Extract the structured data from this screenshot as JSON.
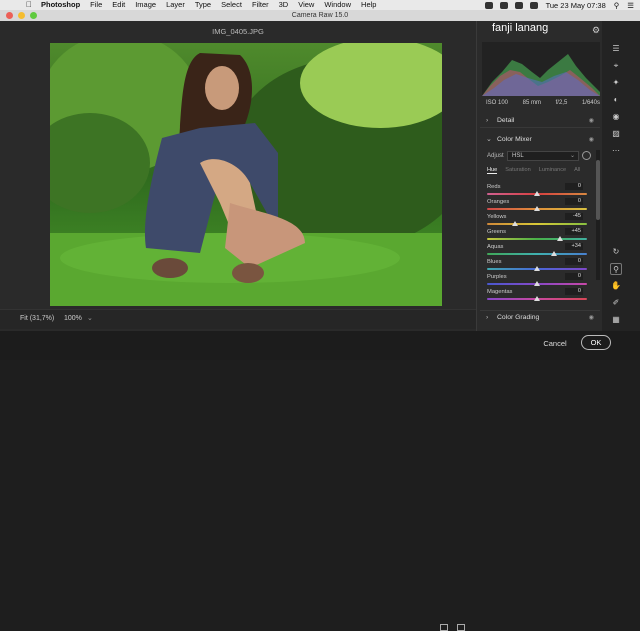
{
  "menubar": {
    "app": "Photoshop",
    "items": [
      "File",
      "Edit",
      "Image",
      "Layer",
      "Type",
      "Select",
      "Filter",
      "3D",
      "View",
      "Window",
      "Help"
    ],
    "datetime": "Tue 23 May  07:38"
  },
  "window": {
    "title": "Camera Raw 15.0"
  },
  "image": {
    "filename": "IMG_0405.JPG"
  },
  "bottom": {
    "fit": "Fit (31,7%)",
    "zoom": "100%"
  },
  "panel": {
    "user": "fanji lanang",
    "camera": {
      "iso": "ISO 100",
      "focal": "85 mm",
      "aperture": "f/2,5",
      "shutter": "1/640s"
    },
    "sections": {
      "detail": "Detail",
      "color_mixer": "Color Mixer",
      "color_grading": "Color Grading"
    },
    "adjust_label": "Adjust",
    "adjust_value": "HSL",
    "tabs": [
      "Hue",
      "Saturation",
      "Luminance",
      "All"
    ],
    "sliders": [
      {
        "name": "Reds",
        "value": "0",
        "pos": 0.5,
        "color": "linear-gradient(90deg,#d06090,#d84040,#d88840)"
      },
      {
        "name": "Oranges",
        "value": "0",
        "pos": 0.5,
        "color": "linear-gradient(90deg,#d04848,#e0903a,#d8c040)"
      },
      {
        "name": "Yellows",
        "value": "-45",
        "pos": 0.275,
        "color": "linear-gradient(90deg,#d08838,#d8c838,#88c040)"
      },
      {
        "name": "Greens",
        "value": "+45",
        "pos": 0.725,
        "color": "linear-gradient(90deg,#c8c840,#48b048,#40b0a0)"
      },
      {
        "name": "Aquas",
        "value": "+34",
        "pos": 0.67,
        "color": "linear-gradient(90deg,#40a858,#40b0b0,#4880d0)"
      },
      {
        "name": "Blues",
        "value": "0",
        "pos": 0.5,
        "color": "linear-gradient(90deg,#40a8b0,#4868d8,#8048c8)"
      },
      {
        "name": "Purples",
        "value": "0",
        "pos": 0.5,
        "color": "linear-gradient(90deg,#4858d0,#8848c8,#c848a8)"
      },
      {
        "name": "Magentas",
        "value": "0",
        "pos": 0.5,
        "color": "linear-gradient(90deg,#8848c8,#c848a0,#d84858)"
      }
    ]
  },
  "buttons": {
    "cancel": "Cancel",
    "ok": "OK"
  }
}
